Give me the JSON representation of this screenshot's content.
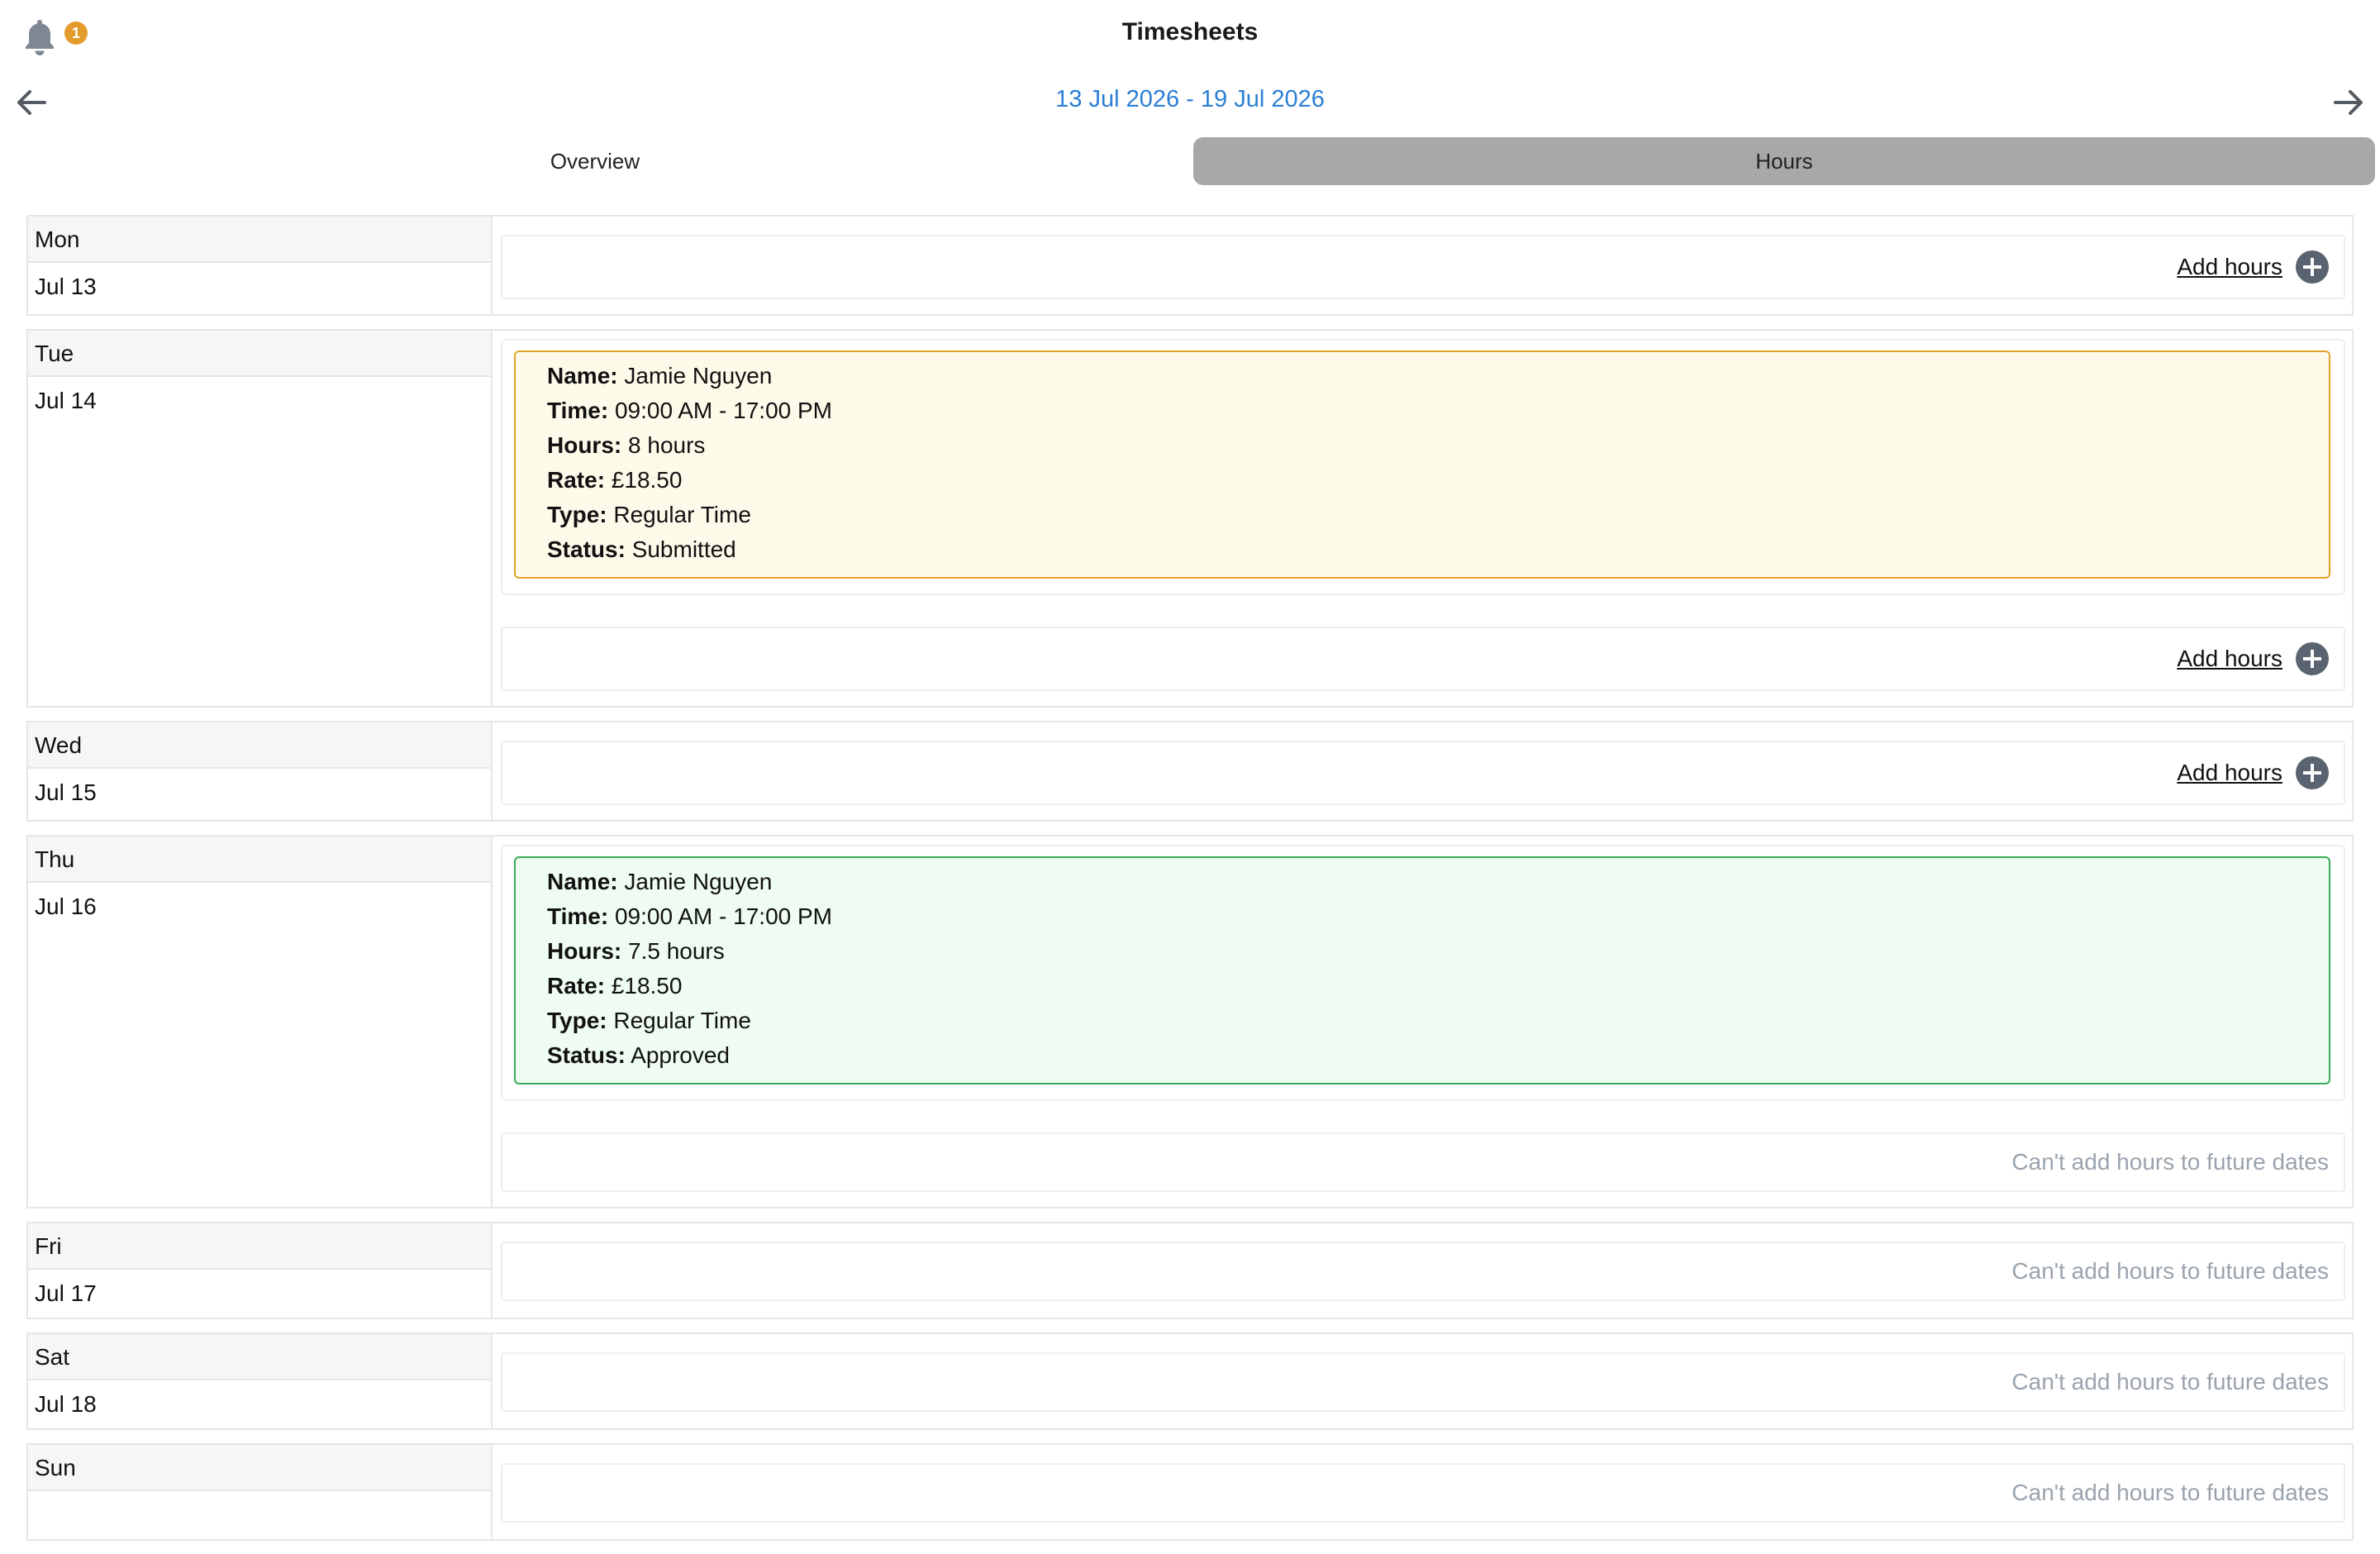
{
  "header": {
    "title": "Timesheets",
    "notification_count": "1",
    "bell_icon": "bell-icon"
  },
  "week_nav": {
    "range": "13 Jul 2026 - 19 Jul 2026",
    "prev_icon": "arrow-left-icon",
    "next_icon": "arrow-right-icon",
    "link_color": "#2b7fd6"
  },
  "tabs": [
    {
      "label": "Overview",
      "active": false
    },
    {
      "label": "Hours",
      "active": true
    }
  ],
  "labels": {
    "name": "Name:",
    "time": "Time:",
    "hours": "Hours:",
    "rate": "Rate:",
    "type": "Type:",
    "status": "Status:",
    "add_hours": "Add hours",
    "future": "Can't add hours to future dates"
  },
  "colors": {
    "submitted_border": "#e2a228",
    "submitted_bg": "#fefaea",
    "approved_border": "#3aab5a",
    "approved_bg": "#eefcf1",
    "active_tab": "#a8a8a8",
    "badge": "#e39b2b"
  },
  "days": [
    {
      "day": "Mon",
      "date": "Jul 13"
    },
    {
      "day": "Tue",
      "date": "Jul 14",
      "entry": {
        "name": "Jamie Nguyen",
        "time": "09:00 AM - 17:00 PM",
        "hours": "8 hours",
        "rate": "£18.50",
        "type": "Regular Time",
        "status": "Submitted"
      }
    },
    {
      "day": "Wed",
      "date": "Jul 15"
    },
    {
      "day": "Thu",
      "date": "Jul 16",
      "entry": {
        "name": "Jamie Nguyen",
        "time": "09:00 AM - 17:00 PM",
        "hours": "7.5 hours",
        "rate": "£18.50",
        "type": "Regular Time",
        "status": "Approved"
      }
    },
    {
      "day": "Fri",
      "date": "Jul 17"
    },
    {
      "day": "Sat",
      "date": "Jul 18"
    },
    {
      "day": "Sun",
      "date": ""
    }
  ]
}
